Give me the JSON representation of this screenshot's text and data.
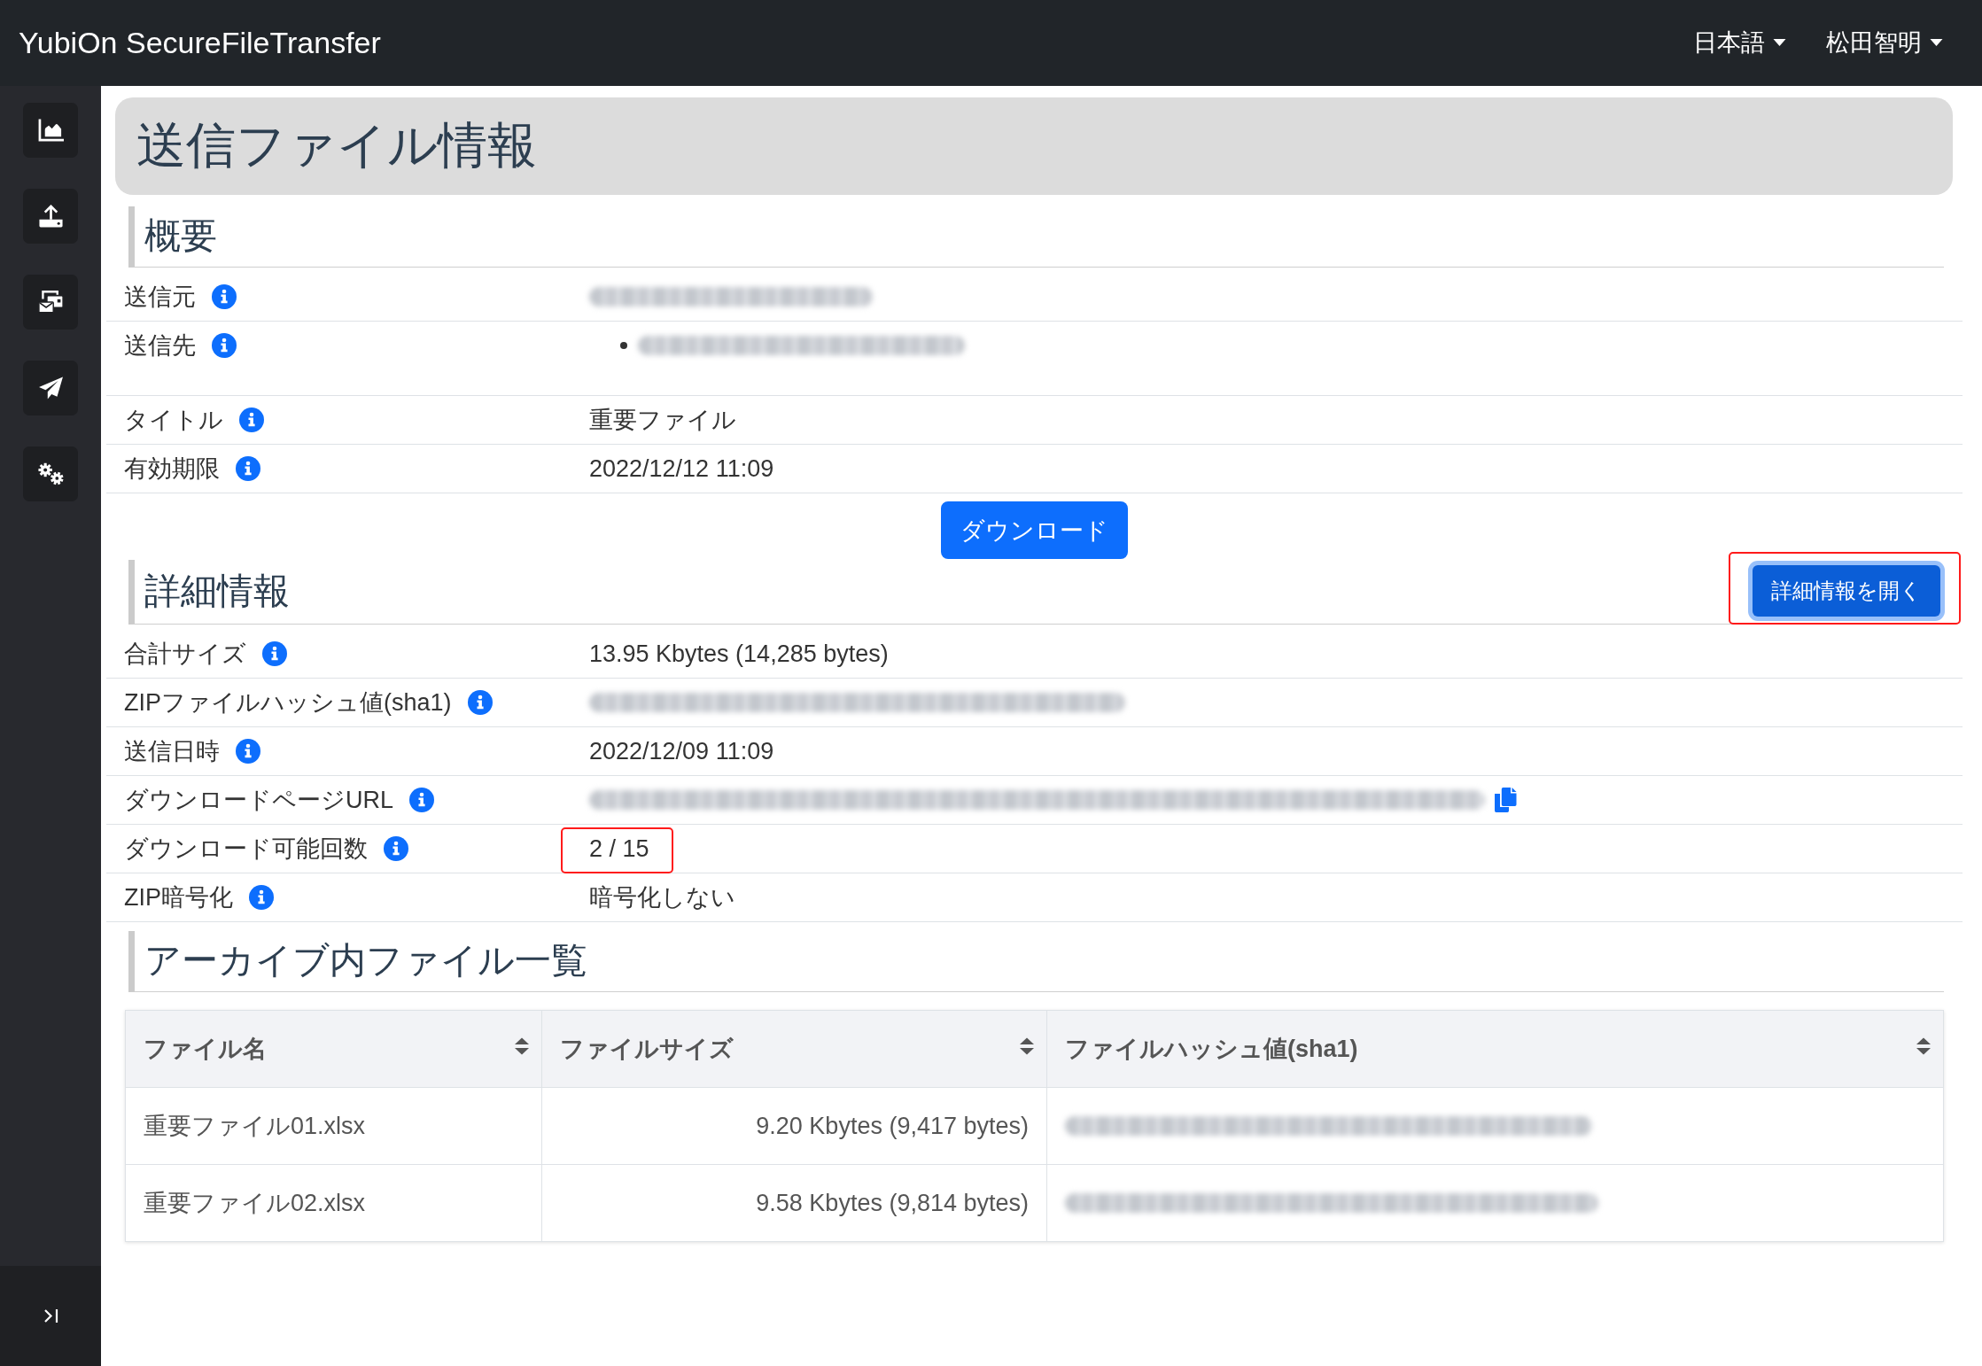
{
  "navbar": {
    "brand": "YubiOn SecureFileTransfer",
    "menus": [
      {
        "label": "日本語"
      },
      {
        "label": "松田智明"
      }
    ]
  },
  "sidebar": {
    "items": [
      {
        "kind": "chart"
      },
      {
        "kind": "upload"
      },
      {
        "kind": "mail"
      },
      {
        "kind": "send"
      },
      {
        "kind": "settings"
      }
    ]
  },
  "page_title": "送信ファイル情報",
  "overview": {
    "heading": "概要",
    "rows": [
      {
        "label": "送信元",
        "kind": "blurred",
        "copyable": false,
        "highlighted": false
      },
      {
        "label": "送信先",
        "kind": "list",
        "items": [
          {
            "kind": "blurred"
          }
        ],
        "copyable": false,
        "highlighted": false
      },
      {
        "label": "タイトル",
        "kind": "text",
        "value": "重要ファイル",
        "copyable": false,
        "highlighted": false
      },
      {
        "label": "有効期限",
        "kind": "text",
        "value": "2022/12/12 11:09",
        "copyable": false,
        "highlighted": false
      }
    ],
    "download_button": "ダウンロード"
  },
  "details": {
    "heading": "詳細情報",
    "open_button": {
      "label": "詳細情報を開く",
      "focused": true,
      "highlighted": true
    },
    "rows": [
      {
        "label": "合計サイズ",
        "kind": "text",
        "value": "13.95 Kbytes (14,285 bytes)",
        "copyable": false,
        "highlighted": false
      },
      {
        "label": "ZIPファイルハッシュ値(sha1)",
        "kind": "blurred",
        "copyable": false,
        "highlighted": false
      },
      {
        "label": "送信日時",
        "kind": "text",
        "value": "2022/12/09 11:09",
        "copyable": false,
        "highlighted": false
      },
      {
        "label": "ダウンロードページURL",
        "kind": "blurred",
        "copyable": true,
        "highlighted": false
      },
      {
        "label": "ダウンロード可能回数",
        "kind": "text",
        "value": "2 / 15",
        "copyable": false,
        "highlighted": true
      },
      {
        "label": "ZIP暗号化",
        "kind": "text",
        "value": "暗号化しない",
        "copyable": false,
        "highlighted": false
      }
    ]
  },
  "archive": {
    "heading": "アーカイブ内ファイル一覧",
    "table": {
      "columns": [
        {
          "label": "ファイル名"
        },
        {
          "label": "ファイルサイズ"
        },
        {
          "label": "ファイルハッシュ値(sha1)"
        }
      ],
      "rows": [
        {
          "cells": [
            {
              "kind": "text",
              "text": "重要ファイル01.xlsx"
            },
            {
              "kind": "number",
              "text": "9.20 Kbytes (9,417 bytes)"
            },
            {
              "kind": "blurred"
            }
          ]
        },
        {
          "cells": [
            {
              "kind": "text",
              "text": "重要ファイル02.xlsx"
            },
            {
              "kind": "number",
              "text": "9.58 Kbytes (9,814 bytes)"
            },
            {
              "kind": "blurred"
            }
          ]
        }
      ]
    }
  }
}
